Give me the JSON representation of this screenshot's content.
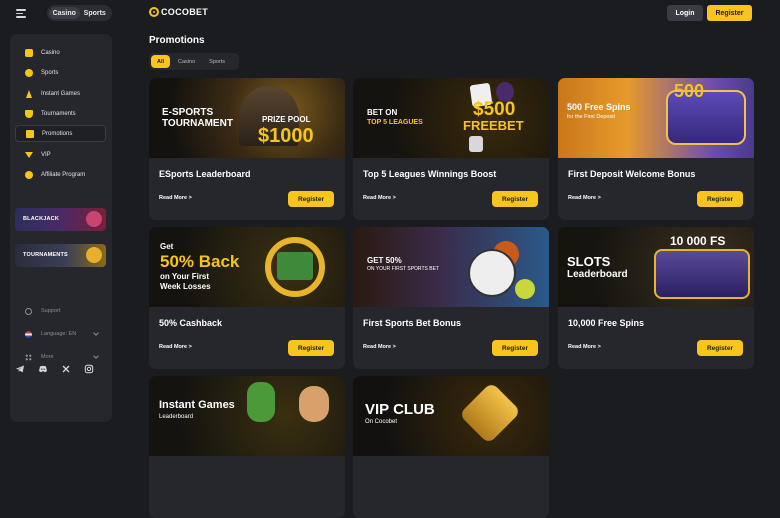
{
  "header": {
    "switch": [
      "Casino",
      "Sports"
    ],
    "logo_text": "COCOBET",
    "login_label": "Login",
    "register_label": "Register"
  },
  "sidebar": {
    "items": [
      {
        "label": "Casino",
        "icon": "cards-icon"
      },
      {
        "label": "Sports",
        "icon": "ball-icon"
      },
      {
        "label": "Instant Games",
        "icon": "rocket-icon"
      },
      {
        "label": "Tournaments",
        "icon": "trophy-icon"
      },
      {
        "label": "Promotions",
        "icon": "gift-icon"
      },
      {
        "label": "VIP",
        "icon": "crown-icon"
      },
      {
        "label": "Affiliate Program",
        "icon": "coin-icon"
      }
    ],
    "active": "Promotions",
    "banners": [
      "BLACKJACK",
      "TOURNAMENTS"
    ],
    "support_label": "Support",
    "language_label": "Language: EN",
    "more_label": "More",
    "socials": [
      "telegram-icon",
      "discord-icon",
      "x-icon",
      "instagram-icon"
    ]
  },
  "main": {
    "title": "Promotions",
    "filters": [
      "All",
      "Casino",
      "Sports"
    ],
    "active_filter": "All",
    "read_more": "Read More >",
    "register": "Register",
    "cards": [
      {
        "title": "ESports Leaderboard",
        "image_text": [
          "E-SPORTS",
          "TOURNAMENT",
          "PRIZE POOL",
          "$1000"
        ]
      },
      {
        "title": "Top 5 Leagues Winnings Boost",
        "image_text": [
          "BET ON",
          "TOP 5 LEAGUES",
          "$500",
          "FREEBET"
        ]
      },
      {
        "title": "First Deposit Welcome Bonus",
        "image_text": [
          "500 Free Spins",
          "for the First Deposit",
          "500"
        ]
      },
      {
        "title": "50% Cashback",
        "image_text": [
          "Get",
          "50% Back",
          "on Your First",
          "Week Losses"
        ]
      },
      {
        "title": "First Sports Bet Bonus",
        "image_text": [
          "GET 50%",
          "ON YOUR FIRST SPORTS BET"
        ]
      },
      {
        "title": "10,000 Free Spins",
        "image_text": [
          "SLOTS",
          "Leaderboard",
          "10 000 FS"
        ]
      },
      {
        "title": "",
        "image_text": [
          "Instant Games",
          "Leaderboard"
        ]
      },
      {
        "title": "",
        "image_text": [
          "VIP CLUB",
          "On Cocobet"
        ]
      }
    ]
  },
  "colors": {
    "accent": "#f7c51b",
    "background": "#1b1c20",
    "panel": "#26272d"
  }
}
